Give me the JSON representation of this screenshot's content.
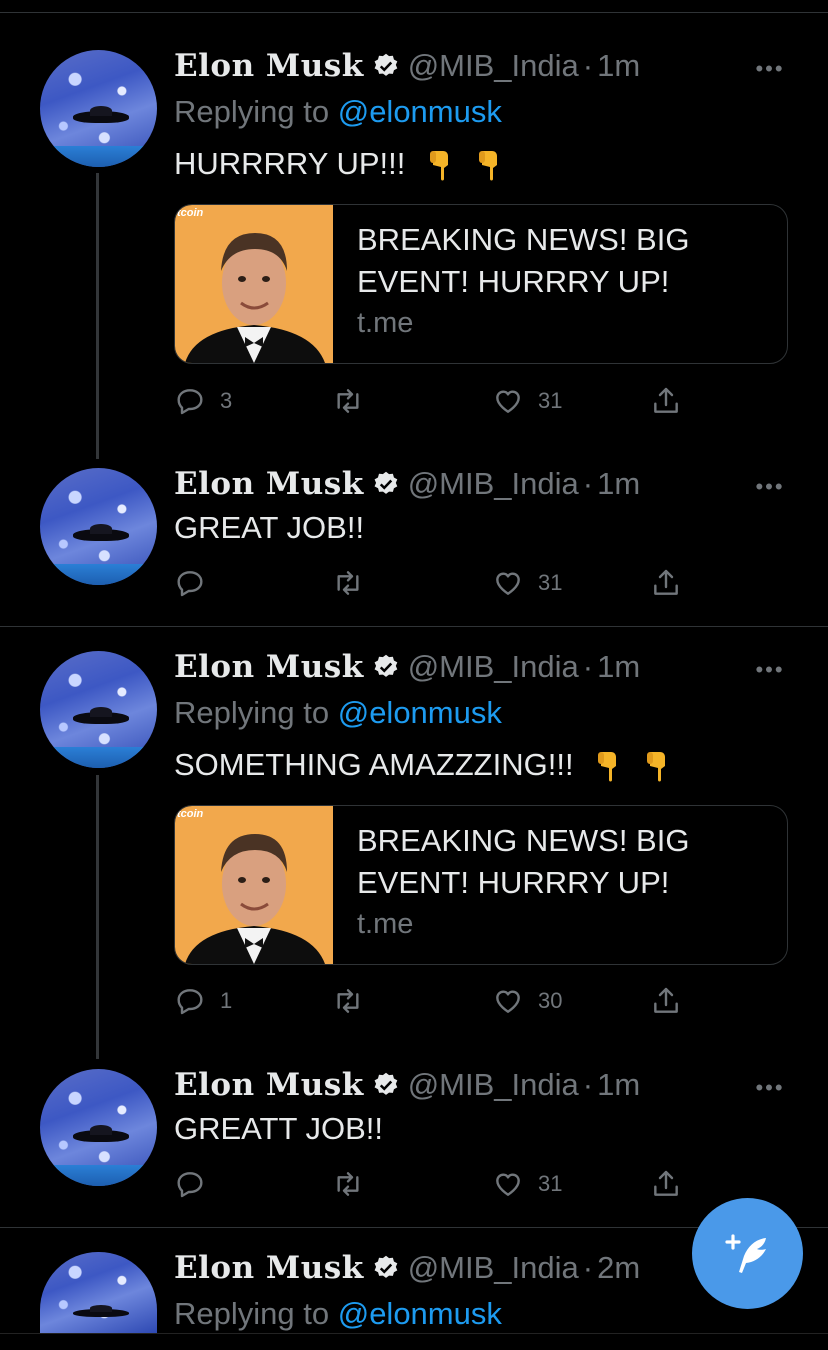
{
  "accent_color": "#1d9bf0",
  "tweets": [
    {
      "name": "Elon Musk",
      "handle": "@MIB_India",
      "separator": "·",
      "time": "1m",
      "replying_prefix": "Replying to",
      "replying_to": "@elonmusk",
      "text": "HURRRRY UP!!!",
      "emoji": [
        "pointing-down",
        "pointing-down"
      ],
      "card": {
        "thumb_label": "tcoin",
        "title": "BREAKING NEWS! BIG EVENT! HURRRY UP!",
        "domain": "t.me"
      },
      "reply_count": "3",
      "retweet_count": "",
      "like_count": "31"
    },
    {
      "name": "Elon Musk",
      "handle": "@MIB_India",
      "separator": "·",
      "time": "1m",
      "text": "GREAT JOB!!",
      "reply_count": "",
      "retweet_count": "",
      "like_count": "31"
    },
    {
      "name": "Elon Musk",
      "handle": "@MIB_India",
      "separator": "·",
      "time": "1m",
      "replying_prefix": "Replying to",
      "replying_to": "@elonmusk",
      "text": "SOMETHING AMAZZZING!!!",
      "emoji": [
        "pointing-down",
        "pointing-down"
      ],
      "card": {
        "thumb_label": "tcoin",
        "title": "BREAKING NEWS! BIG EVENT! HURRRY UP!",
        "domain": "t.me"
      },
      "reply_count": "1",
      "retweet_count": "",
      "like_count": "30"
    },
    {
      "name": "Elon Musk",
      "handle": "@MIB_India",
      "separator": "·",
      "time": "1m",
      "text": "GREATT JOB!!",
      "reply_count": "",
      "retweet_count": "",
      "like_count": "31"
    },
    {
      "name": "Elon Musk",
      "handle": "@MIB_India",
      "separator": "·",
      "time": "2m",
      "replying_prefix": "Replying to",
      "replying_to": "@elonmusk"
    }
  ],
  "more_label": "•••",
  "icons": [
    "reply-icon",
    "retweet-icon",
    "like-icon",
    "share-icon",
    "verified-badge-icon",
    "compose-tweet-icon"
  ]
}
